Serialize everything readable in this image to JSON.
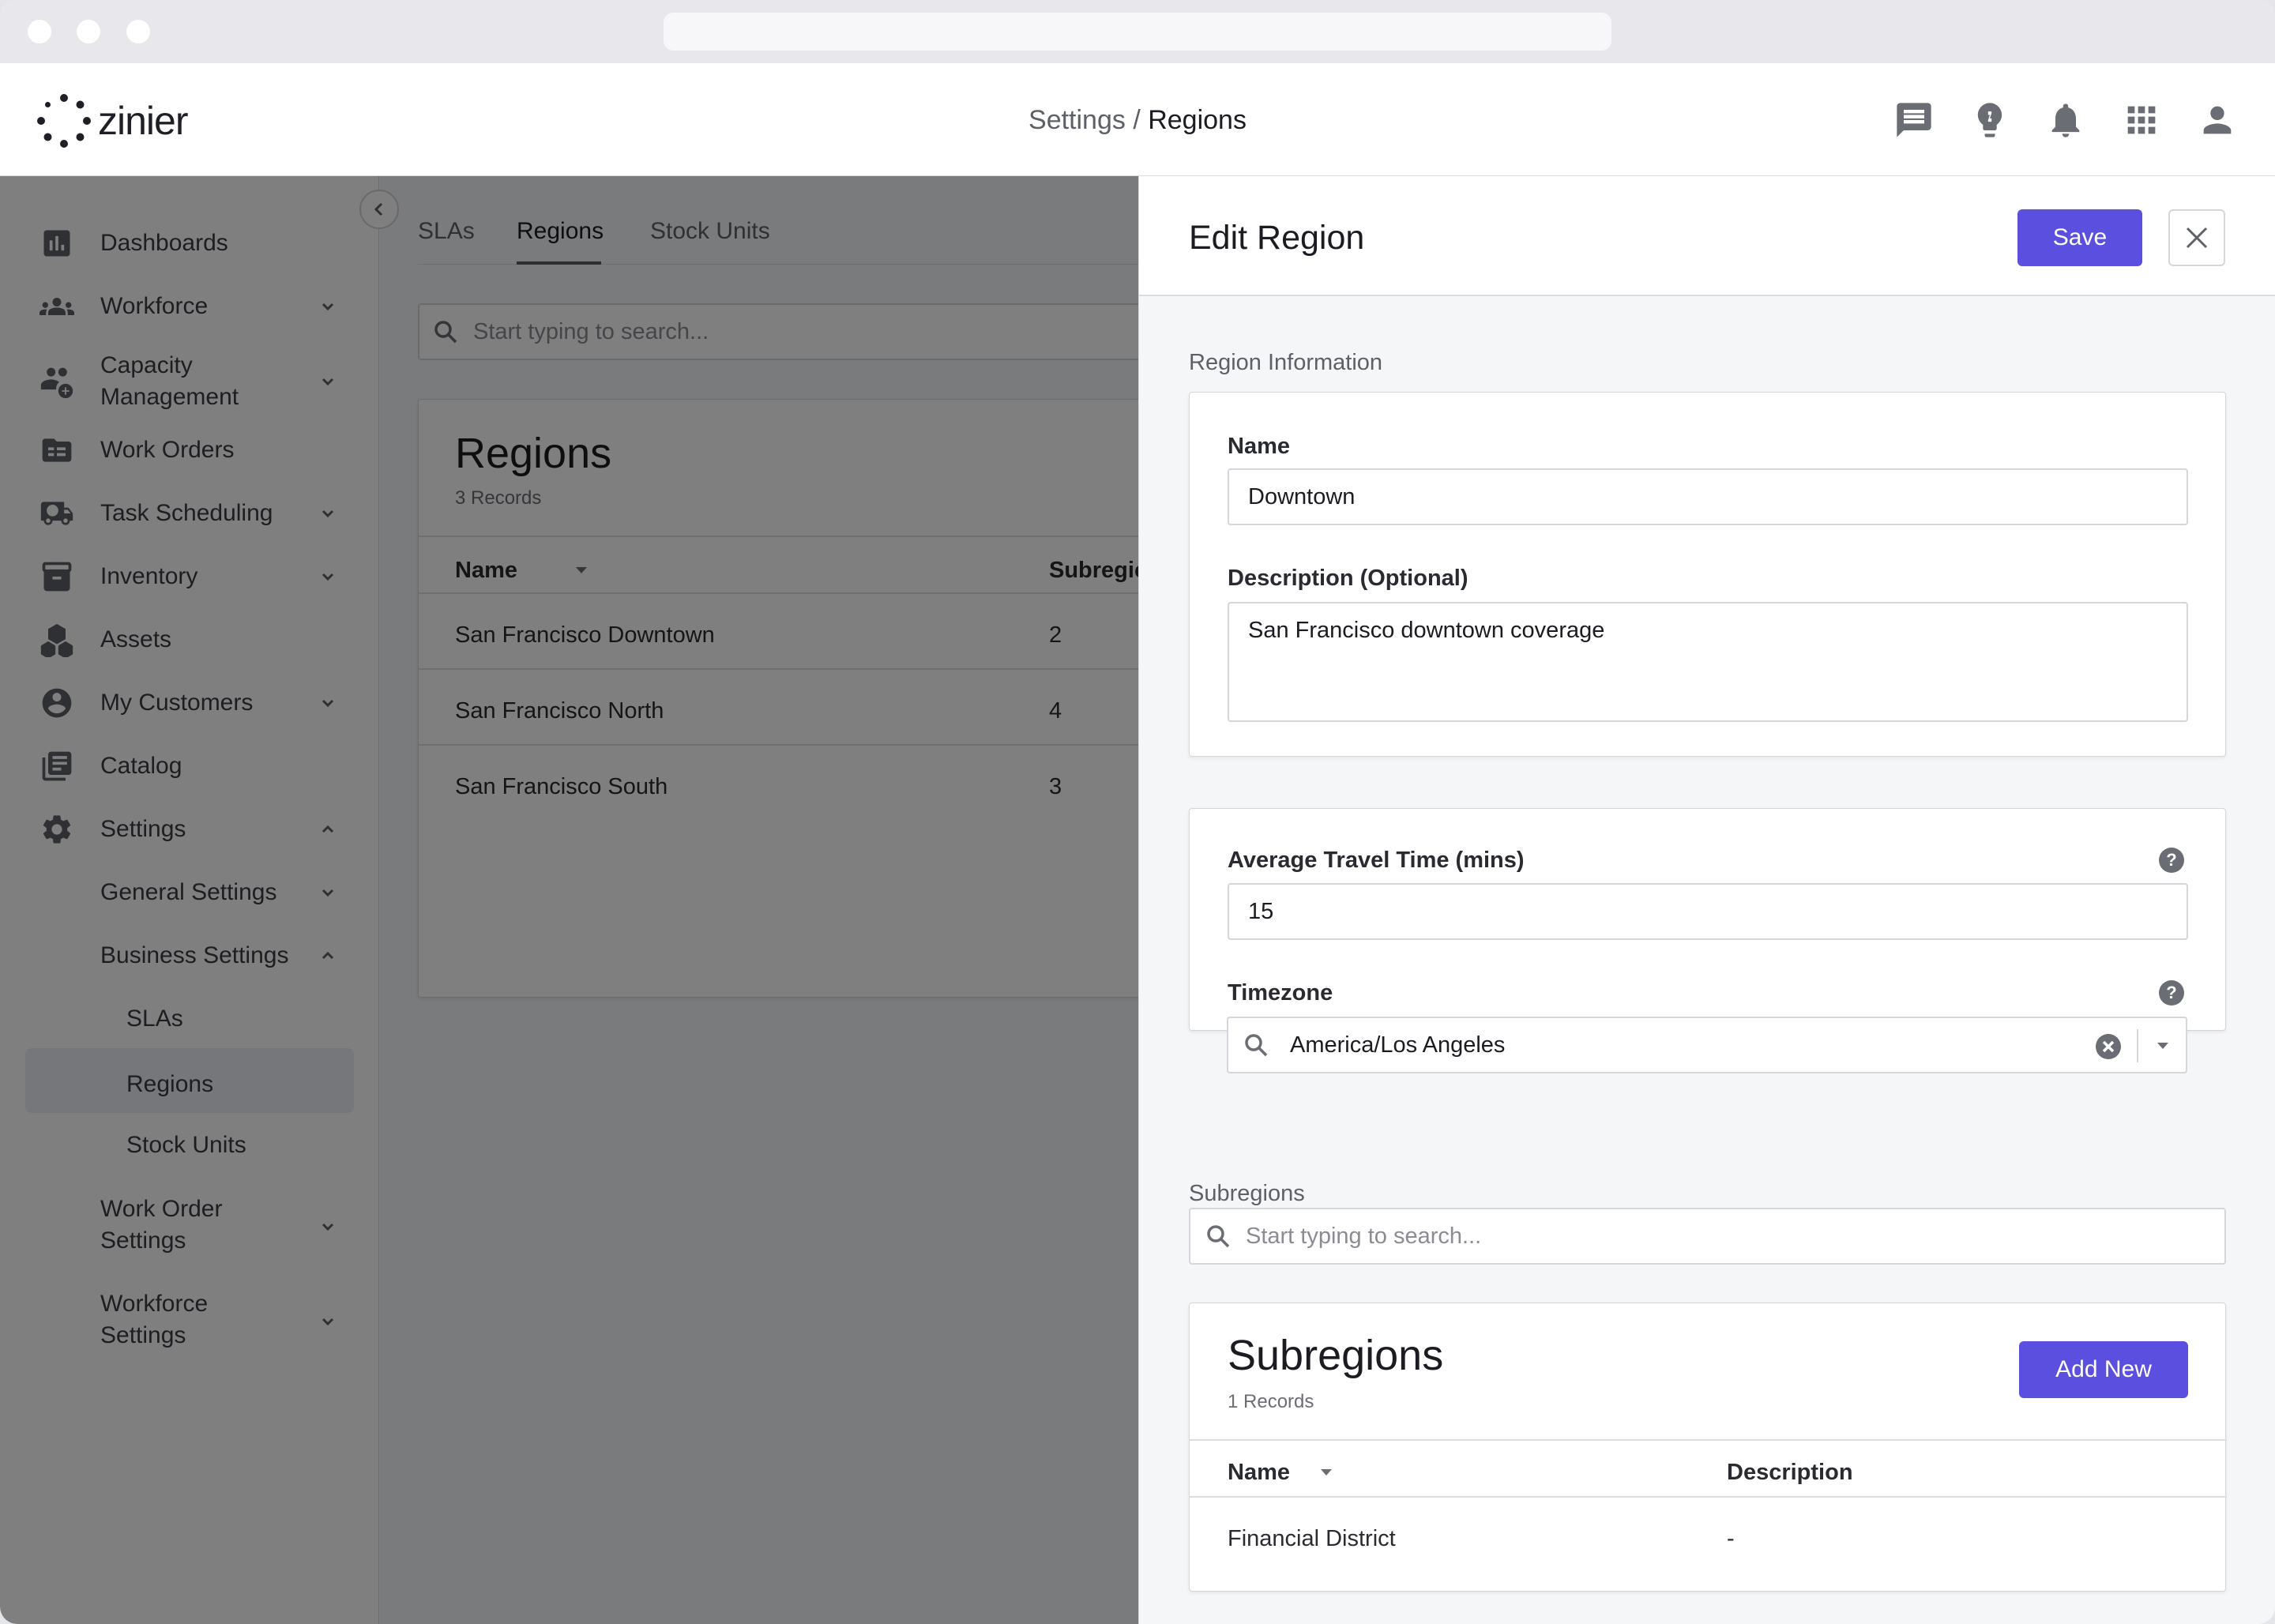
{
  "header": {
    "logo_text": "zinier",
    "breadcrumb_parent": "Settings",
    "breadcrumb_separator": " / ",
    "breadcrumb_current": "Regions",
    "icons": [
      "chat-icon",
      "lightbulb-icon",
      "bell-icon",
      "apps-grid-icon",
      "user-avatar-icon"
    ]
  },
  "sidebar": {
    "items": [
      {
        "label": "Dashboards",
        "icon": "bar-chart-icon"
      },
      {
        "label": "Workforce",
        "icon": "people-icon"
      },
      {
        "label": "Capacity",
        "label2": "Management",
        "icon": "capacity-icon"
      },
      {
        "label": "Work Orders",
        "icon": "work-orders-icon"
      },
      {
        "label": "Task Scheduling",
        "icon": "truck-clock-icon"
      },
      {
        "label": "Inventory",
        "icon": "inventory-icon"
      },
      {
        "label": "Assets",
        "icon": "assets-icon"
      },
      {
        "label": "My Customers",
        "icon": "customer-icon"
      },
      {
        "label": "Catalog",
        "icon": "catalog-icon"
      },
      {
        "label": "Settings",
        "icon": "gear-icon"
      }
    ],
    "settings_children": {
      "general": "General Settings",
      "business": "Business Settings",
      "business_children": [
        "SLAs",
        "Regions",
        "Stock Units"
      ],
      "work_order": "Work Order",
      "work_order2": "Settings",
      "workforce": "Workforce",
      "workforce2": "Settings"
    }
  },
  "main": {
    "tabs": [
      "SLAs",
      "Regions",
      "Stock Units"
    ],
    "active_tab": "Regions",
    "search_placeholder": "Start typing to search...",
    "table": {
      "title": "Regions",
      "records": "3 Records",
      "columns": [
        "Name",
        "Subregic"
      ],
      "rows": [
        [
          "San Francisco Downtown",
          "2"
        ],
        [
          "San Francisco North",
          "4"
        ],
        [
          "San Francisco South",
          "3"
        ]
      ]
    }
  },
  "panel": {
    "title": "Edit Region",
    "save_label": "Save",
    "section_info": "Region Information",
    "name_label": "Name",
    "name_value": "Downtown",
    "description_label": "Description (Optional)",
    "description_value": "San Francisco downtown coverage",
    "travel_label": "Average Travel Time (mins)",
    "travel_value": "15",
    "timezone_label": "Timezone",
    "timezone_value": "America/Los Angeles",
    "subregions_section": "Subregions",
    "subregions_search_placeholder": "Start typing to search...",
    "subregions_table": {
      "title": "Subregions",
      "records": "1 Records",
      "add_label": "Add New",
      "columns": [
        "Name",
        "Description"
      ],
      "rows": [
        [
          "Financial District",
          "-"
        ]
      ]
    }
  },
  "colors": {
    "primary": "#5b4fe0",
    "overlay": "rgba(0,0,0,0.5)",
    "panel_bg": "#f5f6f8"
  }
}
